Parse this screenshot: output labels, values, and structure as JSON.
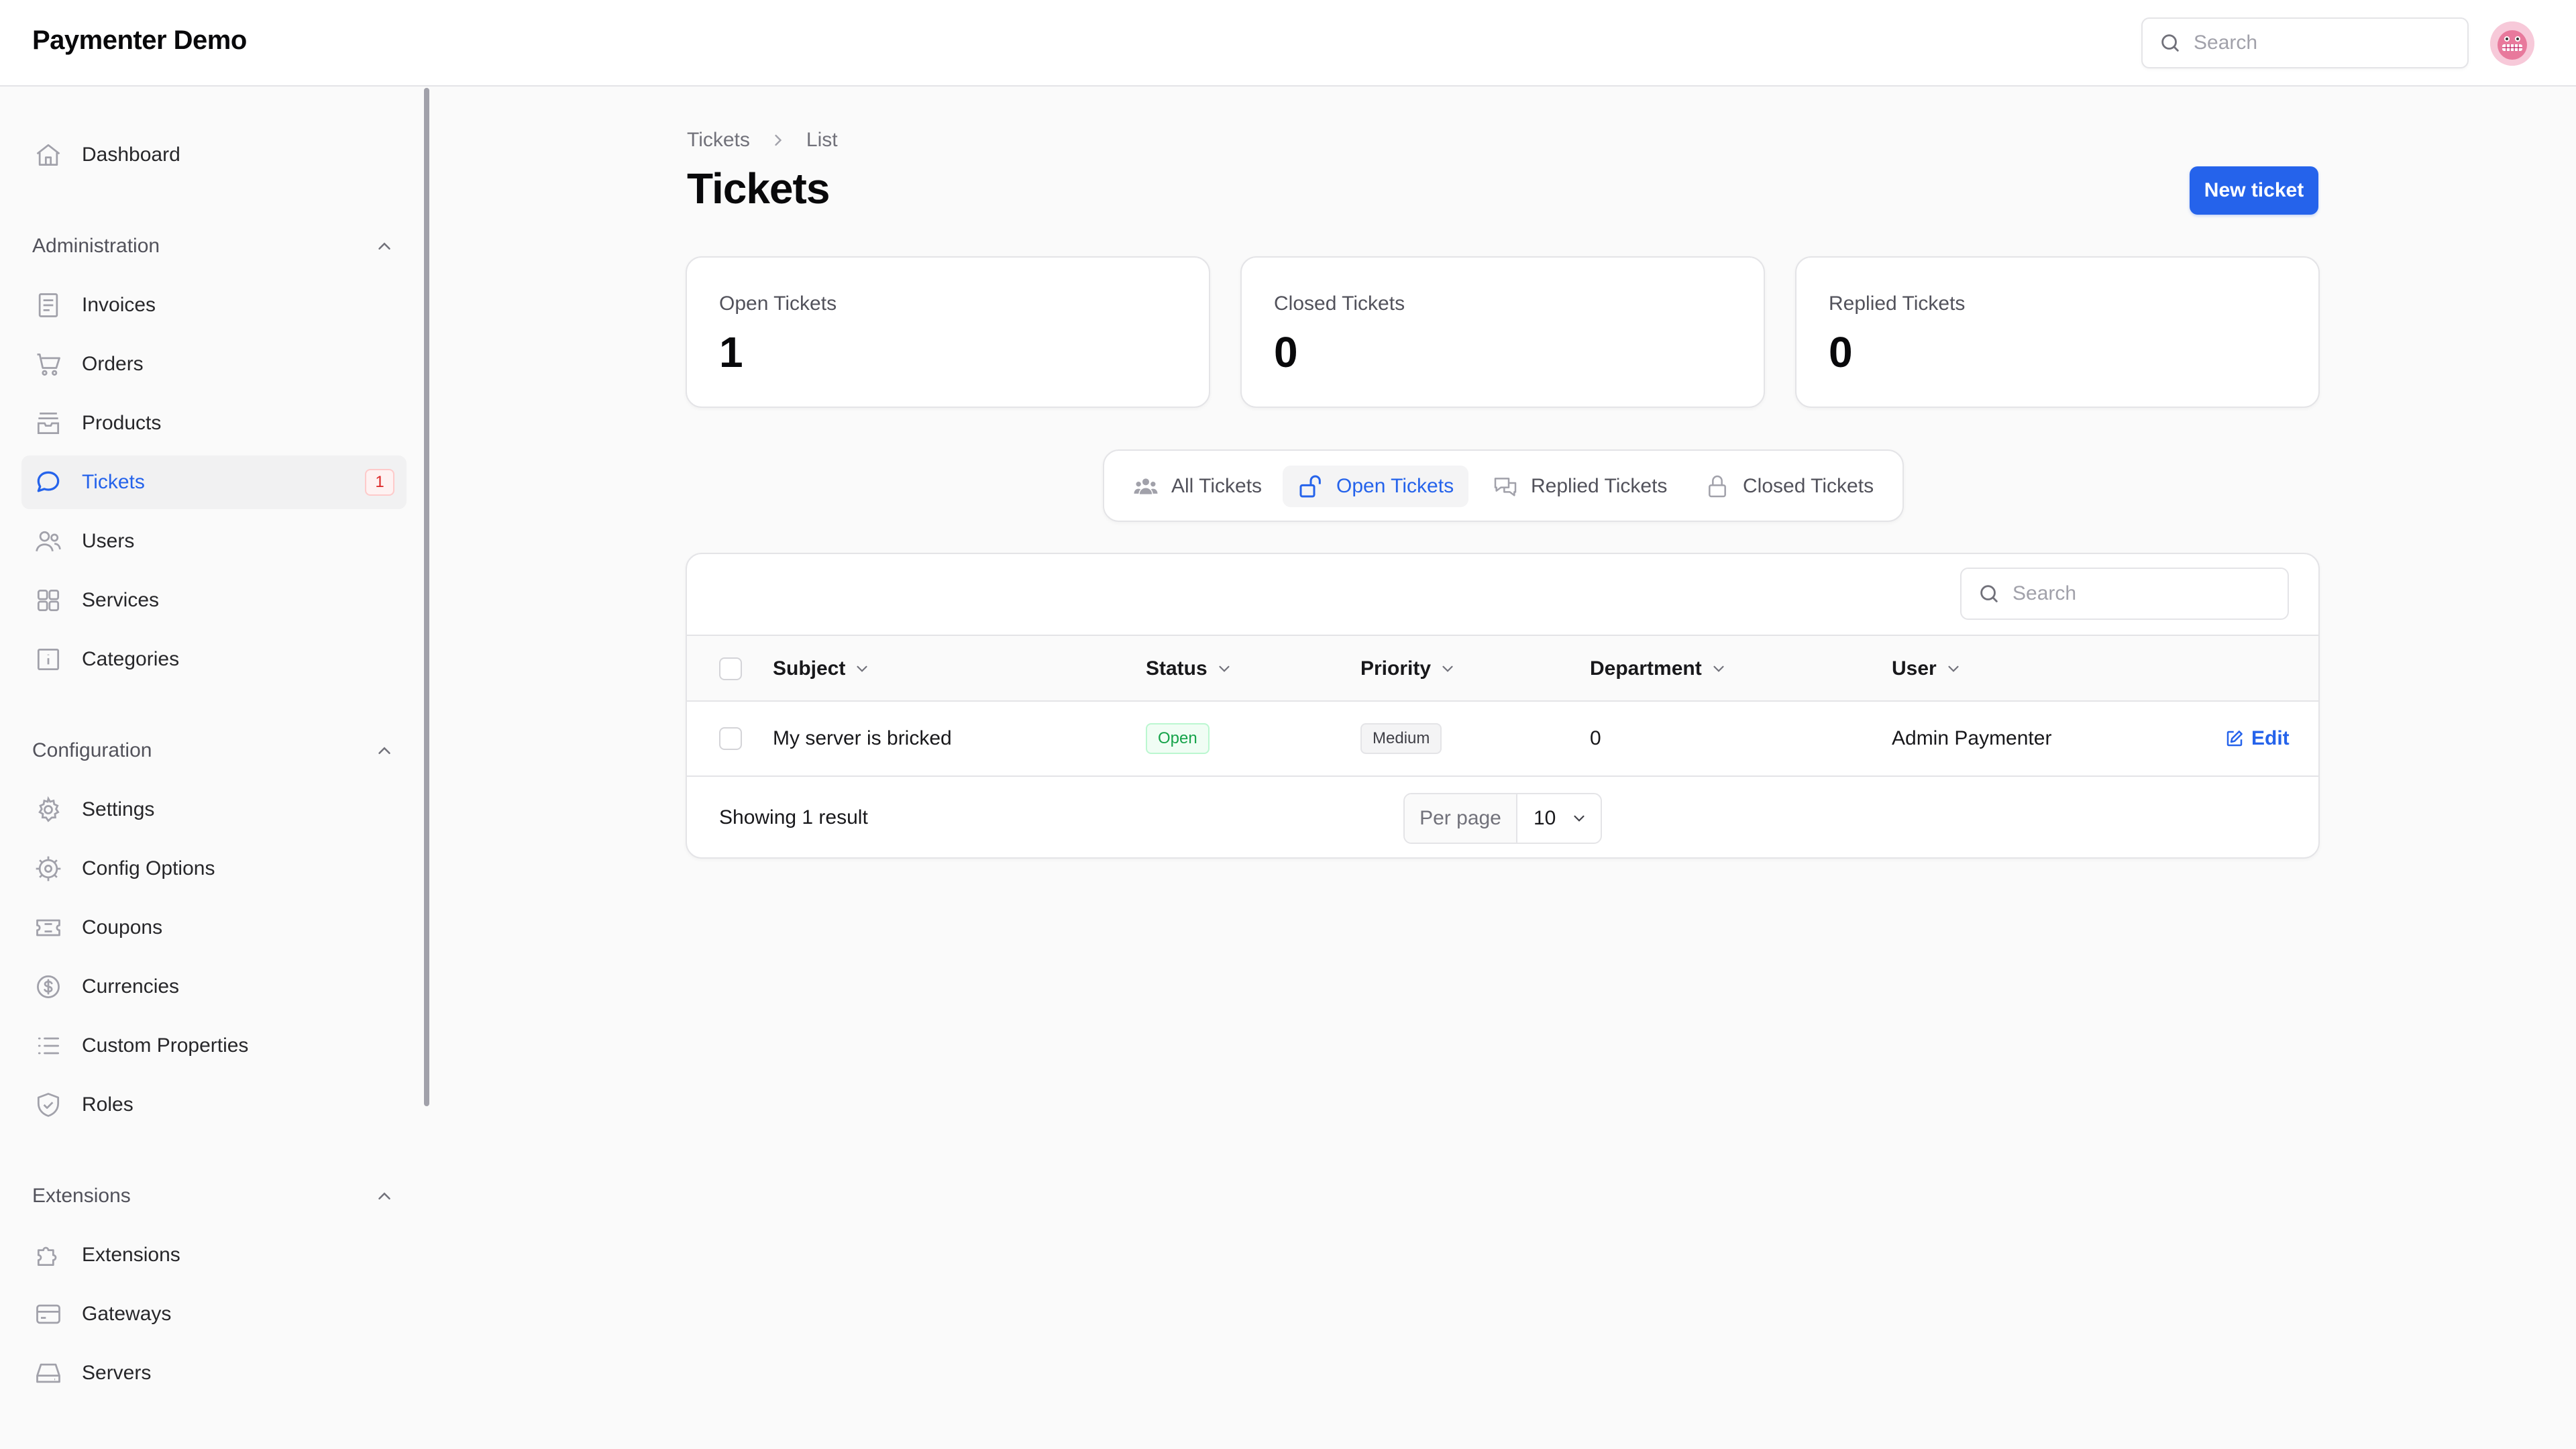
{
  "app": {
    "title": "Paymenter Demo"
  },
  "header": {
    "search_placeholder": "Search"
  },
  "sidebar": {
    "dashboard": "Dashboard",
    "groups": [
      {
        "label": "Administration",
        "items": [
          {
            "label": "Invoices",
            "icon": "document-icon"
          },
          {
            "label": "Orders",
            "icon": "cart-icon"
          },
          {
            "label": "Products",
            "icon": "archive-box-icon"
          },
          {
            "label": "Tickets",
            "icon": "chat-bubble-icon",
            "badge": "1",
            "active": true
          },
          {
            "label": "Users",
            "icon": "users-icon"
          },
          {
            "label": "Services",
            "icon": "grid-icon"
          },
          {
            "label": "Categories",
            "icon": "info-folder-icon"
          }
        ]
      },
      {
        "label": "Configuration",
        "items": [
          {
            "label": "Settings",
            "icon": "gear-icon"
          },
          {
            "label": "Config Options",
            "icon": "cog-icon"
          },
          {
            "label": "Coupons",
            "icon": "ticket-icon"
          },
          {
            "label": "Currencies",
            "icon": "dollar-icon"
          },
          {
            "label": "Custom Properties",
            "icon": "list-icon"
          },
          {
            "label": "Roles",
            "icon": "shield-check-icon"
          }
        ]
      },
      {
        "label": "Extensions",
        "items": [
          {
            "label": "Extensions",
            "icon": "puzzle-icon"
          },
          {
            "label": "Gateways",
            "icon": "credit-card-icon"
          },
          {
            "label": "Servers",
            "icon": "server-icon"
          }
        ]
      }
    ]
  },
  "breadcrumb": [
    "Tickets",
    "List"
  ],
  "page": {
    "title": "Tickets",
    "new_button": "New ticket"
  },
  "stats": [
    {
      "label": "Open Tickets",
      "value": "1"
    },
    {
      "label": "Closed Tickets",
      "value": "0"
    },
    {
      "label": "Replied Tickets",
      "value": "0"
    }
  ],
  "tabs": [
    {
      "label": "All Tickets",
      "icon": "user-group-icon"
    },
    {
      "label": "Open Tickets",
      "icon": "lock-open-icon",
      "active": true
    },
    {
      "label": "Replied Tickets",
      "icon": "chat-bubbles-icon"
    },
    {
      "label": "Closed Tickets",
      "icon": "lock-closed-icon"
    }
  ],
  "table": {
    "search_placeholder": "Search",
    "columns": [
      "Subject",
      "Status",
      "Priority",
      "Department",
      "User"
    ],
    "rows": [
      {
        "subject": "My server is bricked",
        "status": "Open",
        "priority": "Medium",
        "department": "0",
        "user": "Admin Paymenter",
        "action": "Edit"
      }
    ],
    "footer": {
      "showing": "Showing 1 result",
      "per_page_label": "Per page",
      "per_page_value": "10"
    }
  },
  "colors": {
    "accent": "#2563eb",
    "badge_red": "#dc2626",
    "status_green": "#16a34a"
  }
}
